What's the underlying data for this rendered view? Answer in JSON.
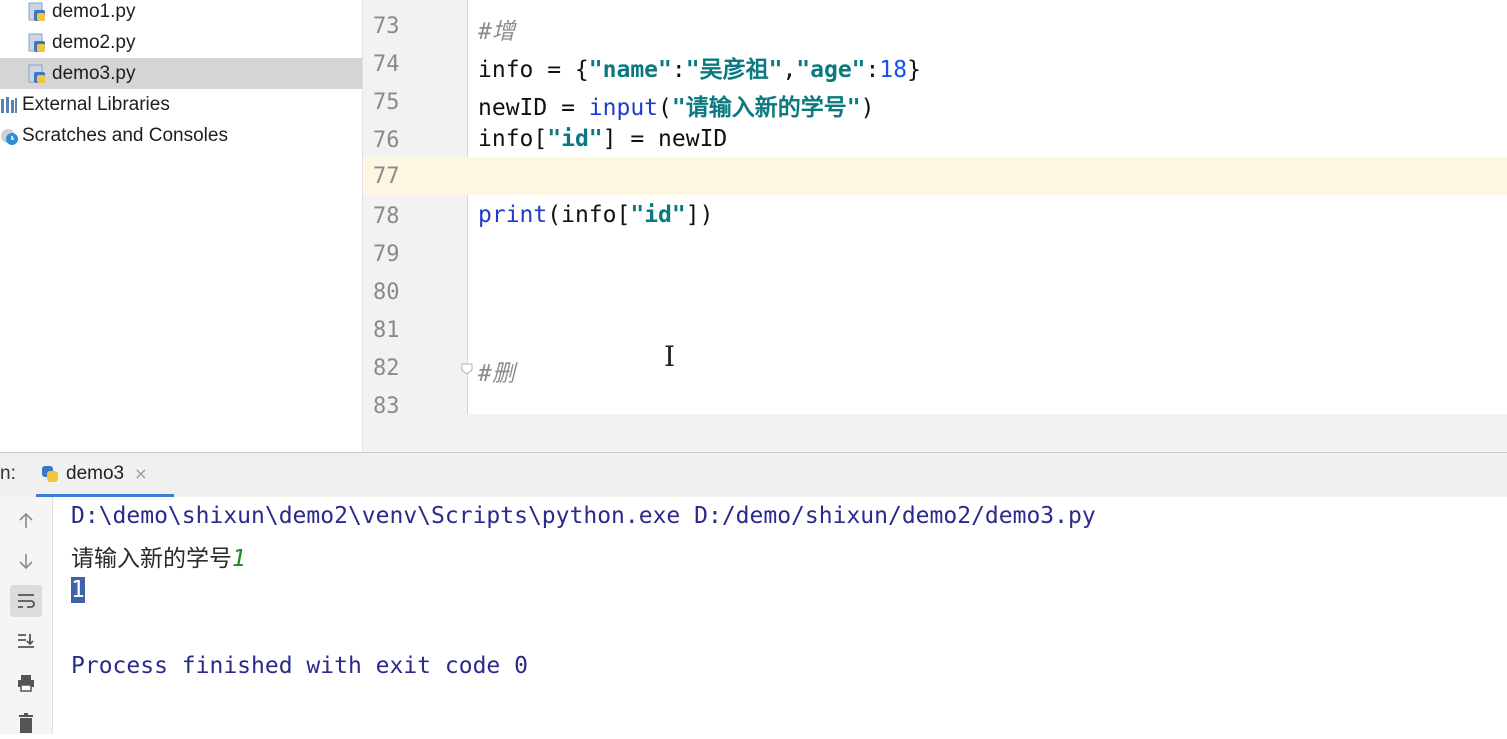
{
  "project_tree": {
    "items": [
      {
        "label": "demo1.py",
        "icon": "python-file-icon",
        "selected": false
      },
      {
        "label": "demo2.py",
        "icon": "python-file-icon",
        "selected": false
      },
      {
        "label": "demo3.py",
        "icon": "python-file-icon",
        "selected": true
      },
      {
        "label": "External Libraries",
        "icon": "library-icon",
        "selected": false
      },
      {
        "label": "Scratches and Consoles",
        "icon": "scratches-icon",
        "selected": false
      }
    ]
  },
  "editor": {
    "current_line": "77",
    "lines": [
      {
        "number": "73",
        "comment": "#增"
      },
      {
        "number": "74",
        "var": "info",
        "eq": " = {",
        "k1": "\"name\"",
        "c1": ":",
        "v1": "\"吴彦祖\"",
        "sep": ",",
        "k2": "\"age\"",
        "c2": ":",
        "v2": "18",
        "close": "}"
      },
      {
        "number": "75",
        "var": "newID",
        "eq": " = ",
        "fn": "input",
        "open": "(",
        "str": "\"请输入新的学号\"",
        "close": ")"
      },
      {
        "number": "76",
        "var": "info[",
        "str": "\"id\"",
        "rest": "] = newID"
      },
      {
        "number": "77"
      },
      {
        "number": "78",
        "fn": "print",
        "open": "(info[",
        "str": "\"id\"",
        "close": "])"
      },
      {
        "number": "79"
      },
      {
        "number": "80"
      },
      {
        "number": "81"
      },
      {
        "number": "82",
        "comment": "#删"
      },
      {
        "number": "83"
      }
    ]
  },
  "run_panel": {
    "label": "n:",
    "tab_label": "demo3",
    "tab_close": "×",
    "console": {
      "command": "D:\\demo\\shixun\\demo2\\venv\\Scripts\\python.exe D:/demo/shixun/demo2/demo3.py",
      "prompt": "请输入新的学号",
      "user_input": "1",
      "output": "1",
      "exit_message": "Process finished with exit code 0"
    }
  },
  "colors": {
    "string": "#0a7a80",
    "number": "#1750eb",
    "function": "#1e3cc8",
    "comment": "#8c8c8c",
    "current_line_bg": "#fdf7e1",
    "tab_underline": "#3d7bd9"
  }
}
